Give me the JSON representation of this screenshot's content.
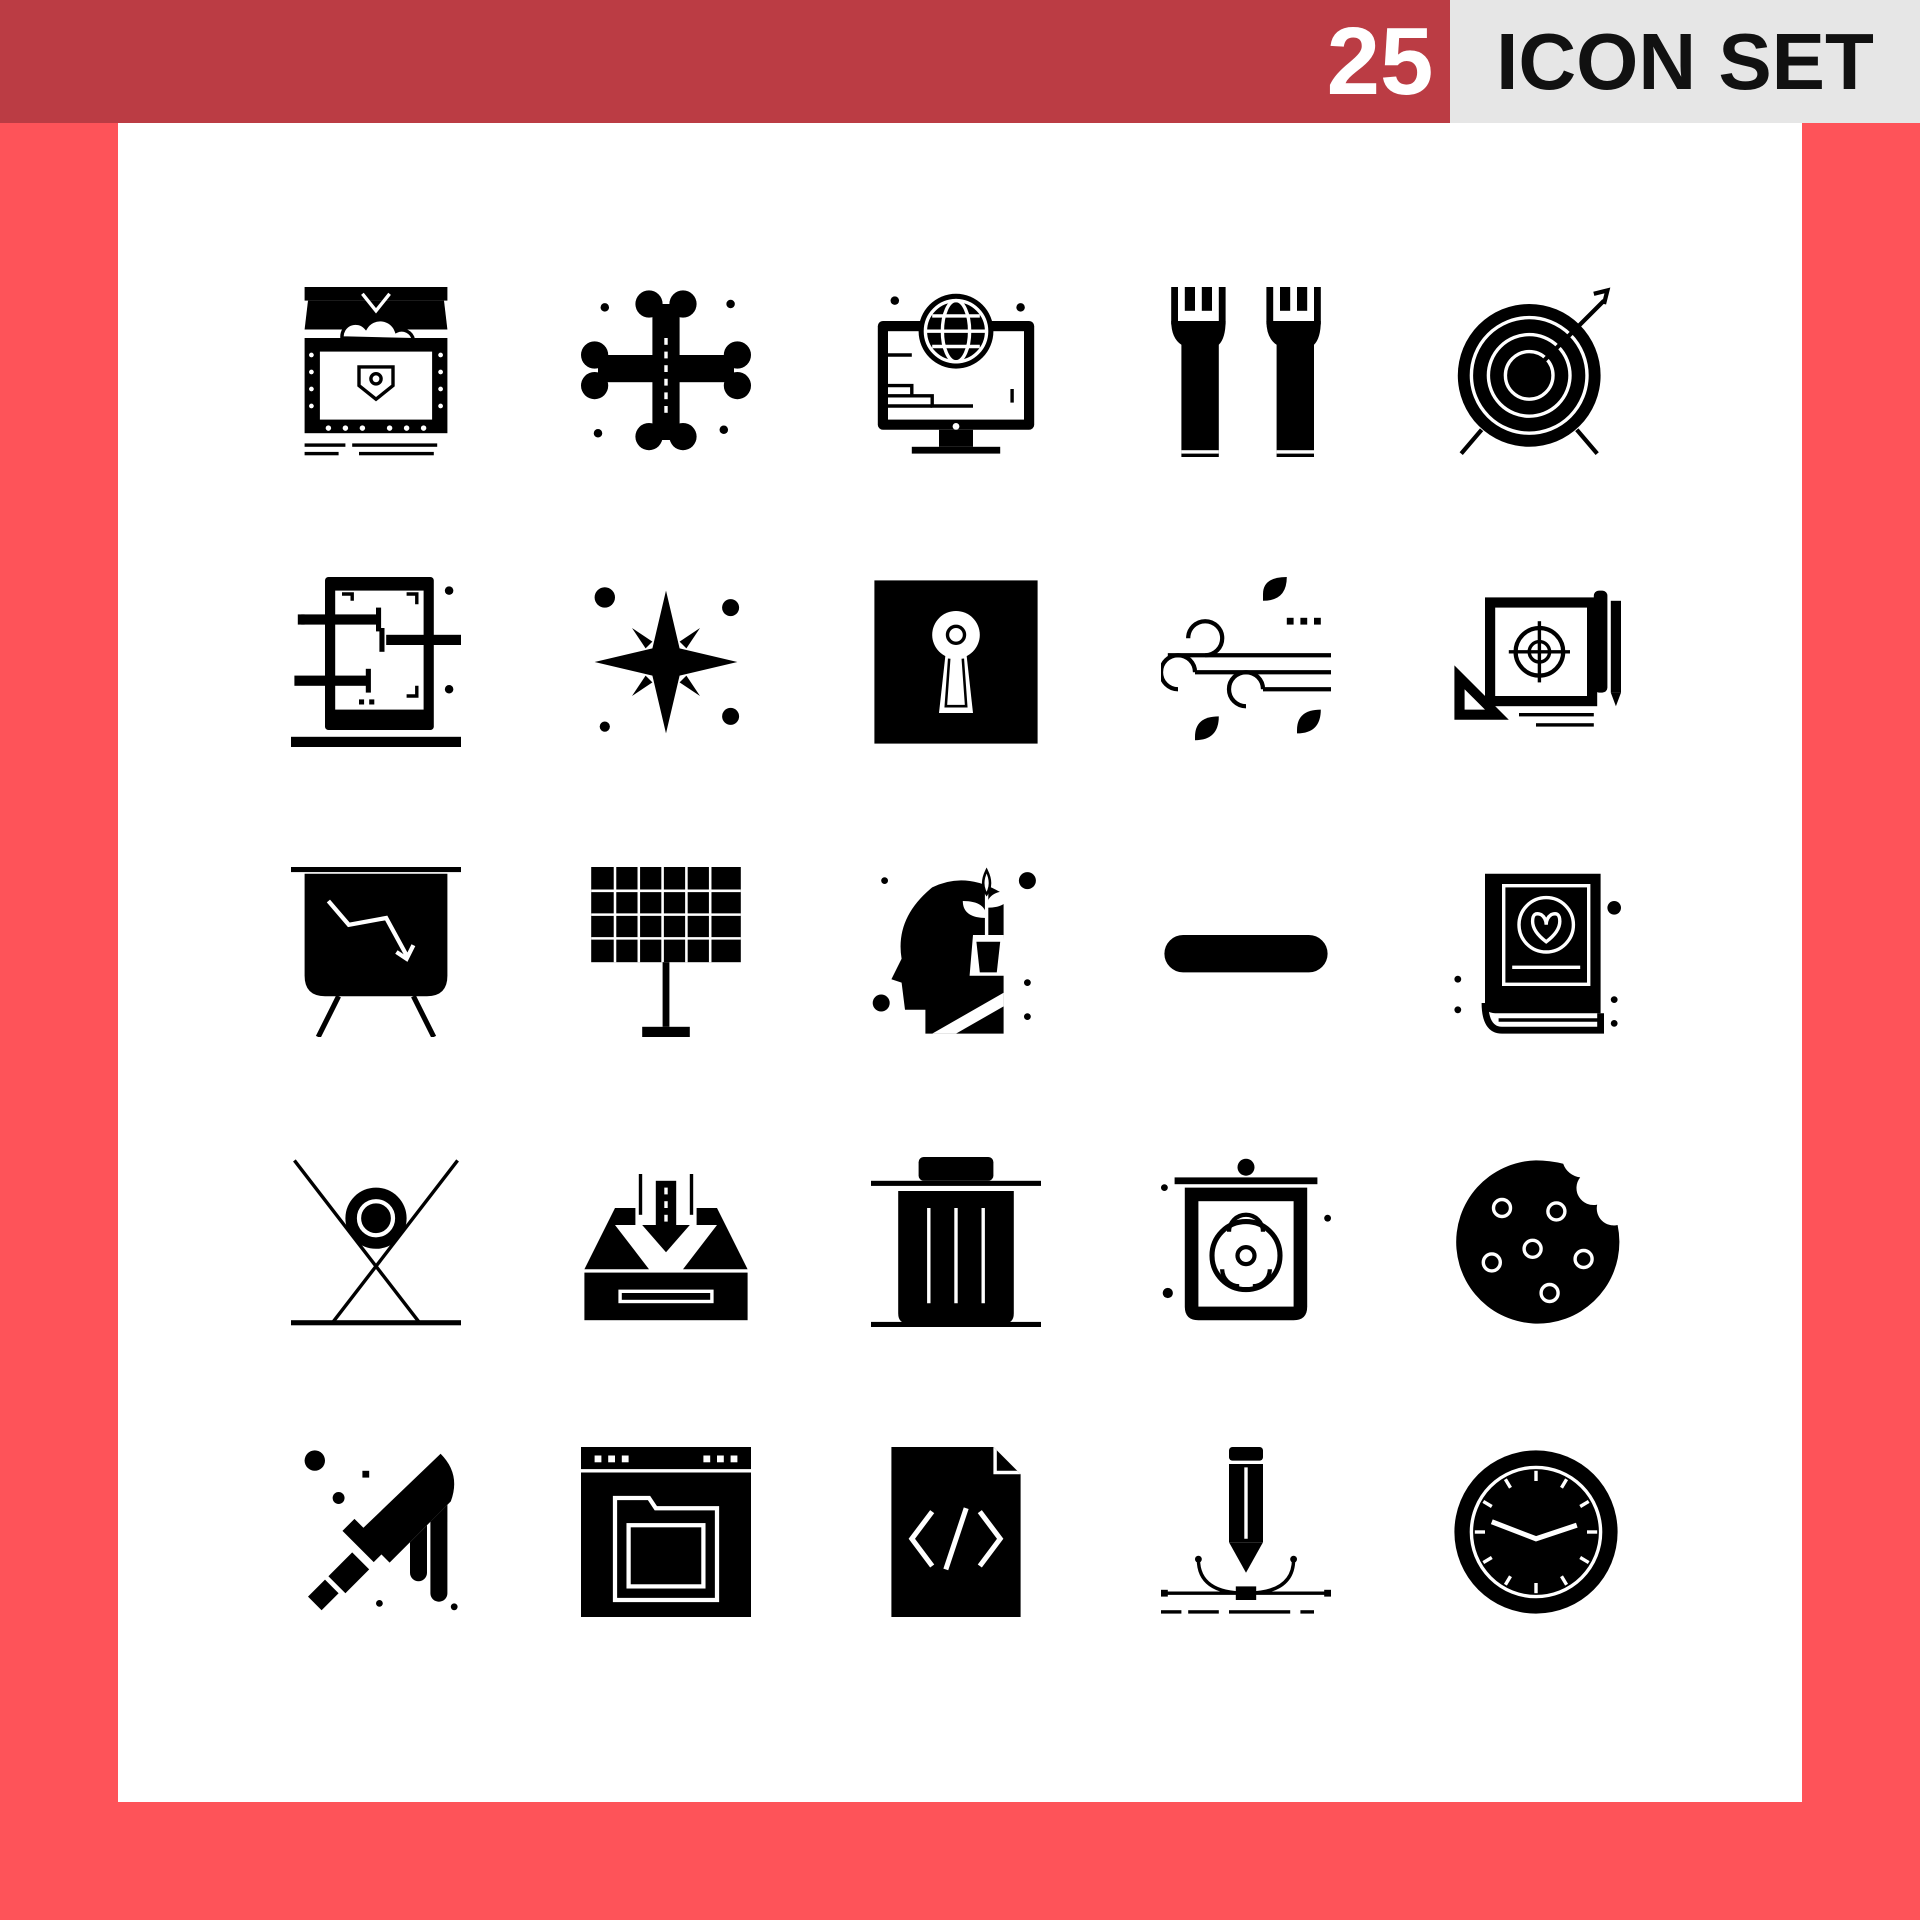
{
  "banner": {
    "number": "25",
    "title": "ICON SET",
    "colors": {
      "banner_left": "#bb3c44",
      "banner_right": "#e6e6e6",
      "background": "#fe5359",
      "canvas": "#ffffff",
      "icon": "#000000"
    }
  },
  "icons": [
    "treasure-chest-icon",
    "crossed-bones-icon",
    "global-monitor-icon",
    "plug-pins-icon",
    "target-arrow-icon",
    "mobile-circuit-icon",
    "sparkle-star-icon",
    "keyhole-icon",
    "wind-leaves-icon",
    "blueprint-target-icon",
    "chart-down-board-icon",
    "solar-panel-icon",
    "mind-growth-icon",
    "minus-icon",
    "love-book-icon",
    "pool-ball-cue-icon",
    "inbox-download-icon",
    "trash-bin-icon",
    "biohazard-container-icon",
    "cookie-icon",
    "knife-icon",
    "browser-folder-icon",
    "code-file-icon",
    "pen-tool-vector-icon",
    "wall-clock-icon"
  ]
}
